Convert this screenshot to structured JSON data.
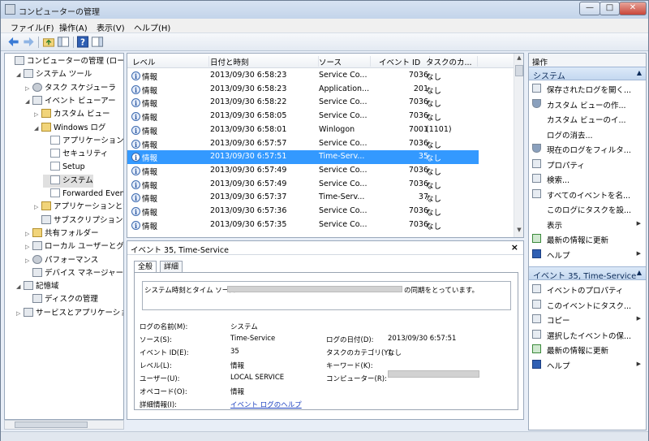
{
  "window": {
    "title": "コンピューターの管理",
    "buttons": [
      "—",
      "□",
      "✕"
    ]
  },
  "menu": [
    "ファイル(F)",
    "操作(A)",
    "表示(V)",
    "ヘルプ(H)"
  ],
  "tree": [
    {
      "label": "コンピューターの管理 (ローカル",
      "level": 0,
      "arrow": "",
      "icon": "computer-icon"
    },
    {
      "label": "システム ツール",
      "level": 1,
      "arrow": "◢",
      "icon": "tools-icon"
    },
    {
      "label": "タスク スケジューラ",
      "level": 2,
      "arrow": "▷",
      "icon": "clock-icon"
    },
    {
      "label": "イベント ビューアー",
      "level": 2,
      "arrow": "◢",
      "icon": "event-viewer-icon"
    },
    {
      "label": "カスタム ビュー",
      "level": 3,
      "arrow": "▷",
      "icon": "folder-icon"
    },
    {
      "label": "Windows ログ",
      "level": 3,
      "arrow": "◢",
      "icon": "folder-icon"
    },
    {
      "label": "アプリケーション",
      "level": 4,
      "arrow": "",
      "icon": "log-icon"
    },
    {
      "label": "セキュリティ",
      "level": 4,
      "arrow": "",
      "icon": "log-icon"
    },
    {
      "label": "Setup",
      "level": 4,
      "arrow": "",
      "icon": "log-icon"
    },
    {
      "label": "システム",
      "level": 4,
      "arrow": "",
      "icon": "log-icon",
      "selected": true
    },
    {
      "label": "Forwarded Events",
      "level": 4,
      "arrow": "",
      "icon": "log-icon"
    },
    {
      "label": "アプリケーションとサ",
      "level": 3,
      "arrow": "▷",
      "icon": "folder-icon"
    },
    {
      "label": "サブスクリプション",
      "level": 3,
      "arrow": "",
      "icon": "subscription-icon"
    },
    {
      "label": "共有フォルダー",
      "level": 2,
      "arrow": "▷",
      "icon": "shared-folder-icon"
    },
    {
      "label": "ローカル ユーザーとグル",
      "level": 2,
      "arrow": "▷",
      "icon": "users-icon"
    },
    {
      "label": "パフォーマンス",
      "level": 2,
      "arrow": "▷",
      "icon": "performance-icon"
    },
    {
      "label": "デバイス マネージャー",
      "level": 2,
      "arrow": "",
      "icon": "device-manager-icon"
    },
    {
      "label": "記憶域",
      "level": 1,
      "arrow": "◢",
      "icon": "storage-icon"
    },
    {
      "label": "ディスクの管理",
      "level": 2,
      "arrow": "",
      "icon": "disk-icon"
    },
    {
      "label": "サービスとアプリケーション",
      "level": 1,
      "arrow": "▷",
      "icon": "services-icon"
    }
  ],
  "list": {
    "columns": [
      "レベル",
      "日付と時刻",
      "ソース",
      "イベント ID",
      "タスクのカ..."
    ],
    "rows": [
      [
        "情報",
        "2013/09/30 6:58:23",
        "Service Co...",
        "7036",
        "なし"
      ],
      [
        "情報",
        "2013/09/30 6:58:23",
        "Application...",
        "201",
        "なし"
      ],
      [
        "情報",
        "2013/09/30 6:58:22",
        "Service Co...",
        "7036",
        "なし"
      ],
      [
        "情報",
        "2013/09/30 6:58:05",
        "Service Co...",
        "7036",
        "なし"
      ],
      [
        "情報",
        "2013/09/30 6:58:01",
        "Winlogon",
        "7001",
        "(1101)"
      ],
      [
        "情報",
        "2013/09/30 6:57:57",
        "Service Co...",
        "7036",
        "なし"
      ],
      [
        "情報",
        "2013/09/30 6:57:51",
        "Time-Serv...",
        "35",
        "なし"
      ],
      [
        "情報",
        "2013/09/30 6:57:49",
        "Service Co...",
        "7036",
        "なし"
      ],
      [
        "情報",
        "2013/09/30 6:57:49",
        "Service Co...",
        "7036",
        "なし"
      ],
      [
        "情報",
        "2013/09/30 6:57:37",
        "Time-Serv...",
        "37",
        "なし"
      ],
      [
        "情報",
        "2013/09/30 6:57:36",
        "Service Co...",
        "7036",
        "なし"
      ],
      [
        "情報",
        "2013/09/30 6:57:35",
        "Service Co...",
        "7036",
        "なし"
      ]
    ],
    "selected_index": 6
  },
  "detail": {
    "header": "イベント 35, Time-Service",
    "close": "×",
    "tabs": [
      "全般",
      "詳細"
    ],
    "message_prefix": "システム時刻とタイム ソース",
    "message_suffix": "の同期をとっています。",
    "fields_left": [
      [
        "ログの名前(M):",
        "システム"
      ],
      [
        "ソース(S):",
        "Time-Service"
      ],
      [
        "イベント ID(E):",
        "35"
      ],
      [
        "レベル(L):",
        "情報"
      ],
      [
        "ユーザー(U):",
        "LOCAL SERVICE"
      ],
      [
        "オペコード(O):",
        "情報"
      ],
      [
        "詳細情報(I):",
        "イベント ログのヘルプ"
      ]
    ],
    "fields_right": [
      [
        "ログの日付(D):",
        "2013/09/30 6:57:51"
      ],
      [
        "タスクのカテゴリ(Y):",
        "なし"
      ],
      [
        "キーワード(K):",
        ""
      ],
      [
        "コンピューター(R):",
        ""
      ]
    ]
  },
  "actions": {
    "header": "操作",
    "section1": "システム",
    "section1_items": [
      {
        "label": "保存されたログを開く...",
        "icon": "open-log-icon"
      },
      {
        "label": "カスタム ビューの作...",
        "icon": "filter-icon"
      },
      {
        "label": "カスタム ビューのイ...",
        "icon": ""
      },
      {
        "label": "ログの消去...",
        "icon": ""
      },
      {
        "label": "現在のログをフィルタ...",
        "icon": "filter-icon"
      },
      {
        "label": "プロパティ",
        "icon": "properties-icon"
      },
      {
        "label": "検索...",
        "icon": "find-icon"
      },
      {
        "label": "すべてのイベントを名...",
        "icon": "save-icon"
      },
      {
        "label": "このログにタスクを設...",
        "icon": ""
      },
      {
        "label": "表示",
        "icon": "",
        "submenu": true
      },
      {
        "label": "最新の情報に更新",
        "icon": "refresh-icon"
      },
      {
        "label": "ヘルプ",
        "icon": "help-icon",
        "submenu": true
      }
    ],
    "section2": "イベント 35, Time-Service",
    "section2_items": [
      {
        "label": "イベントのプロパティ",
        "icon": "properties-icon"
      },
      {
        "label": "このイベントにタスク...",
        "icon": "task-icon"
      },
      {
        "label": "コピー",
        "icon": "copy-icon",
        "submenu": true
      },
      {
        "label": "選択したイベントの保...",
        "icon": "save-icon"
      },
      {
        "label": "最新の情報に更新",
        "icon": "refresh-icon"
      },
      {
        "label": "ヘルプ",
        "icon": "help-icon",
        "submenu": true
      }
    ]
  }
}
